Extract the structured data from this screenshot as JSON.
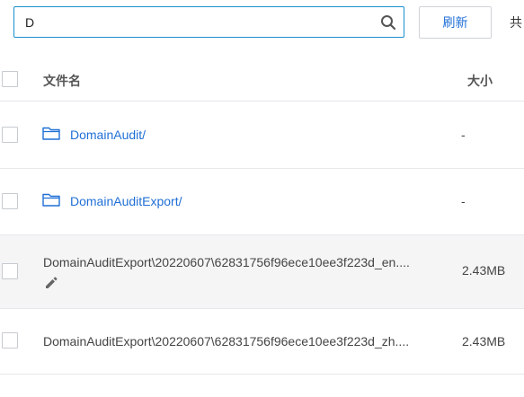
{
  "search": {
    "value": "D",
    "icon": "search-icon"
  },
  "toolbar": {
    "refresh_label": "刷新",
    "total_label": "共"
  },
  "table": {
    "headers": {
      "name": "文件名",
      "size": "大小"
    },
    "rows": [
      {
        "type": "folder",
        "name": "DomainAudit/",
        "size": "-"
      },
      {
        "type": "folder",
        "name": "DomainAuditExport/",
        "size": "-"
      },
      {
        "type": "file",
        "name": "DomainAuditExport\\20220607\\62831756f96ece10ee3f223d_en....",
        "size": "2.43MB"
      },
      {
        "type": "file",
        "name": "DomainAuditExport\\20220607\\62831756f96ece10ee3f223d_zh....",
        "size": "2.43MB"
      }
    ]
  },
  "colors": {
    "accent": "#1f6fd6",
    "search_border": "#1a8fd0",
    "row_highlight": "#f5f5f5"
  }
}
